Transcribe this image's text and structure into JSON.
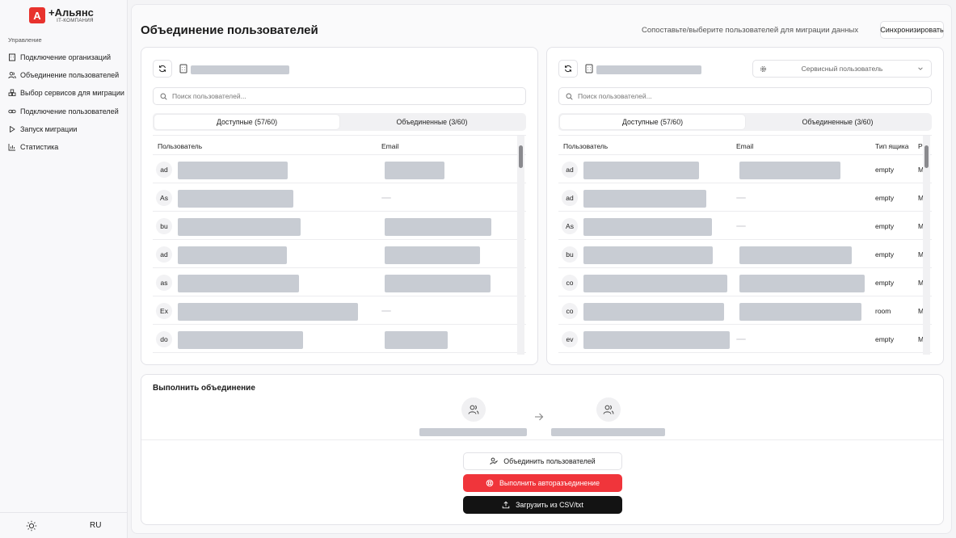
{
  "brand": {
    "mark": "A",
    "title": "+Альянс",
    "subtitle": "IT-КОМПАНИЯ"
  },
  "sidebar": {
    "section": "Управление",
    "items": [
      {
        "label": "Подключение организаций",
        "icon": "building-icon"
      },
      {
        "label": "Объединение пользователей",
        "icon": "users-icon"
      },
      {
        "label": "Выбор сервисов для миграции",
        "icon": "boxes-icon"
      },
      {
        "label": "Подключение пользователей",
        "icon": "link-icon"
      },
      {
        "label": "Запуск миграции",
        "icon": "play-icon"
      },
      {
        "label": "Статистика",
        "icon": "chart-icon"
      }
    ],
    "language": "RU"
  },
  "header": {
    "title": "Объединение пользователей",
    "hint": "Сопоставьте/выберите пользователей для миграции данных",
    "sync_label": "Синхронизировать"
  },
  "left_panel": {
    "search_placeholder": "Поиск пользователей...",
    "tabs": [
      "Доступные (57/60)",
      "Объединенные (3/60)"
    ],
    "columns": [
      "Пользователь",
      "Email"
    ],
    "rows": [
      {
        "initials": "ad",
        "email": true
      },
      {
        "initials": "As",
        "email": false
      },
      {
        "initials": "bu",
        "email": true
      },
      {
        "initials": "ad",
        "email": true
      },
      {
        "initials": "as",
        "email": true
      },
      {
        "initials": "Ex",
        "email": false
      },
      {
        "initials": "do",
        "email": true
      }
    ]
  },
  "right_panel": {
    "search_placeholder": "Поиск пользователей...",
    "tabs": [
      "Доступные (57/60)",
      "Объединенные (3/60)"
    ],
    "select_value": "Сервисный пользователь",
    "columns": [
      "Пользователь",
      "Email",
      "Тип ящика",
      "Р"
    ],
    "rows": [
      {
        "initials": "ad",
        "email": true,
        "type": "empty",
        "extra": "M"
      },
      {
        "initials": "ad",
        "email": false,
        "type": "empty",
        "extra": "M"
      },
      {
        "initials": "As",
        "email": false,
        "type": "empty",
        "extra": "M"
      },
      {
        "initials": "bu",
        "email": true,
        "type": "empty",
        "extra": "M"
      },
      {
        "initials": "co",
        "email": true,
        "type": "empty",
        "extra": "M"
      },
      {
        "initials": "co",
        "email": true,
        "type": "room",
        "extra": "M"
      },
      {
        "initials": "ev",
        "email": false,
        "type": "empty",
        "extra": "M"
      }
    ]
  },
  "merge": {
    "title": "Выполнить объединение",
    "merge_label": "Объединить пользователей",
    "auto_label": "Выполнить авторазъединение",
    "upload_label": "Загрузить из CSV/txt"
  },
  "colors": {
    "accent_red": "#f0353b",
    "brand_red": "#e8322d",
    "dark": "#131313",
    "skeleton": "#c8ccd3"
  }
}
